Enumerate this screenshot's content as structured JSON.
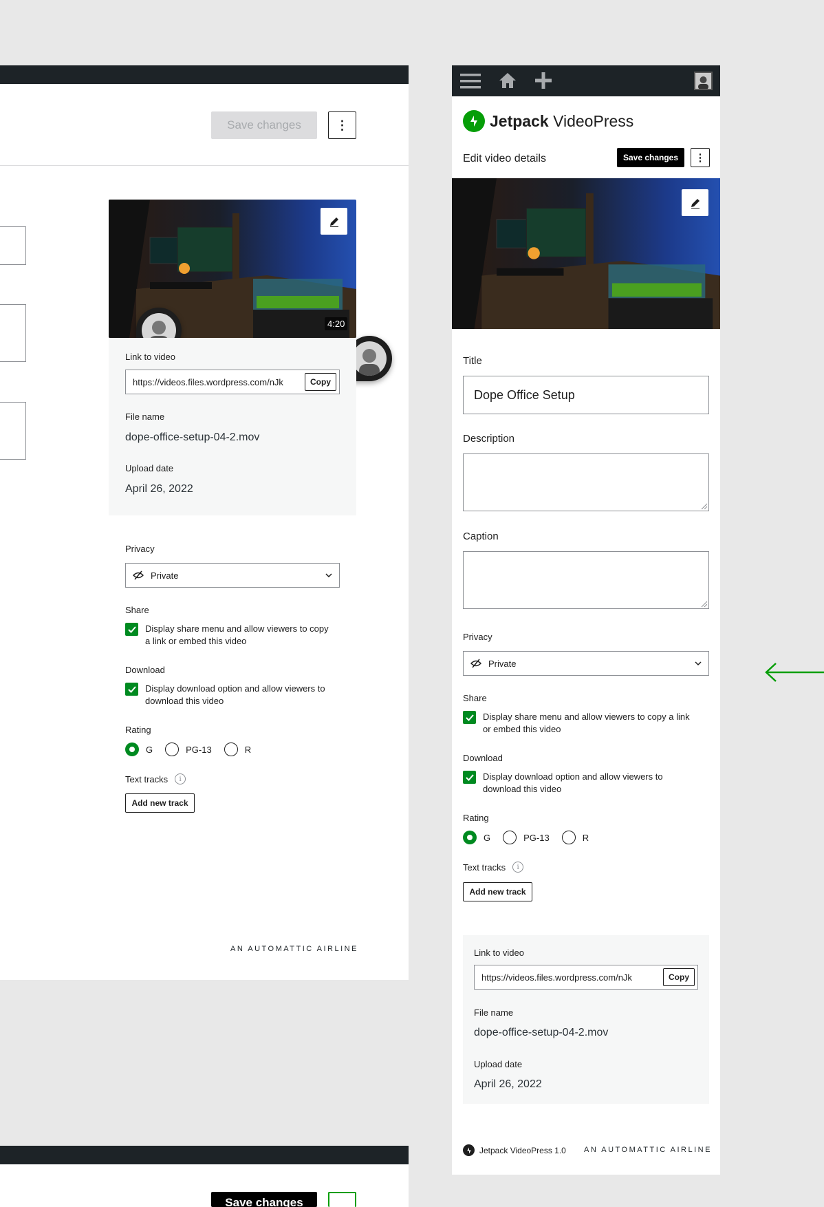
{
  "left": {
    "save_label": "Save changes",
    "duration": "4:20",
    "link_label": "Link to video",
    "link_value": "https://videos.files.wordpress.com/nJk",
    "copy_label": "Copy",
    "filename_label": "File name",
    "filename_value": "dope-office-setup-04-2.mov",
    "upload_label": "Upload date",
    "upload_value": "April 26, 2022",
    "privacy_label": "Privacy",
    "privacy_value": "Private",
    "share_label": "Share",
    "share_text_1": "Display share menu and allow viewers to copy",
    "share_text_2": "a link or embed this video",
    "download_label": "Download",
    "download_text_1": "Display download option and allow viewers to",
    "download_text_2": "download this video",
    "rating_label": "Rating",
    "ratings": [
      "G",
      "PG-13",
      "R"
    ],
    "rating_selected": "G",
    "tracks_label": "Text tracks",
    "add_track_label": "Add new track",
    "footer_automattic": "AN AUTOMATTIC AIRLINE"
  },
  "bottom": {
    "save_label": "Save changes"
  },
  "mobile": {
    "topbar_icons": [
      "menu-icon",
      "home-icon",
      "plus-icon",
      "avatar"
    ],
    "brand_bold": "Jetpack",
    "brand_light": "VideoPress",
    "edit_title": "Edit video details",
    "save_label": "Save changes",
    "title_label": "Title",
    "title_value": "Dope Office Setup",
    "description_label": "Description",
    "caption_label": "Caption",
    "privacy_label": "Privacy",
    "privacy_value": "Private",
    "share_label": "Share",
    "share_text_1": "Display share menu and allow viewers to copy a link",
    "share_text_2": "or embed this video",
    "download_label": "Download",
    "download_text_1": "Display download option and allow viewers to",
    "download_text_2": "download this video",
    "rating_label": "Rating",
    "ratings": [
      "G",
      "PG-13",
      "R"
    ],
    "rating_selected": "G",
    "tracks_label": "Text tracks",
    "add_track_label": "Add new track",
    "link_label": "Link to video",
    "link_value": "https://videos.files.wordpress.com/nJk",
    "copy_label": "Copy",
    "filename_label": "File name",
    "filename_value": "dope-office-setup-04-2.mov",
    "upload_label": "Upload date",
    "upload_value": "April 26, 2022",
    "footer_product": "Jetpack VideoPress 1.0",
    "footer_automattic": "AN AUTOMATTIC AIRLINE"
  },
  "colors": {
    "jetpack_green": "#069e08",
    "check_green": "#008a20",
    "topbar": "#1d2327",
    "arrow": "#069e08"
  }
}
